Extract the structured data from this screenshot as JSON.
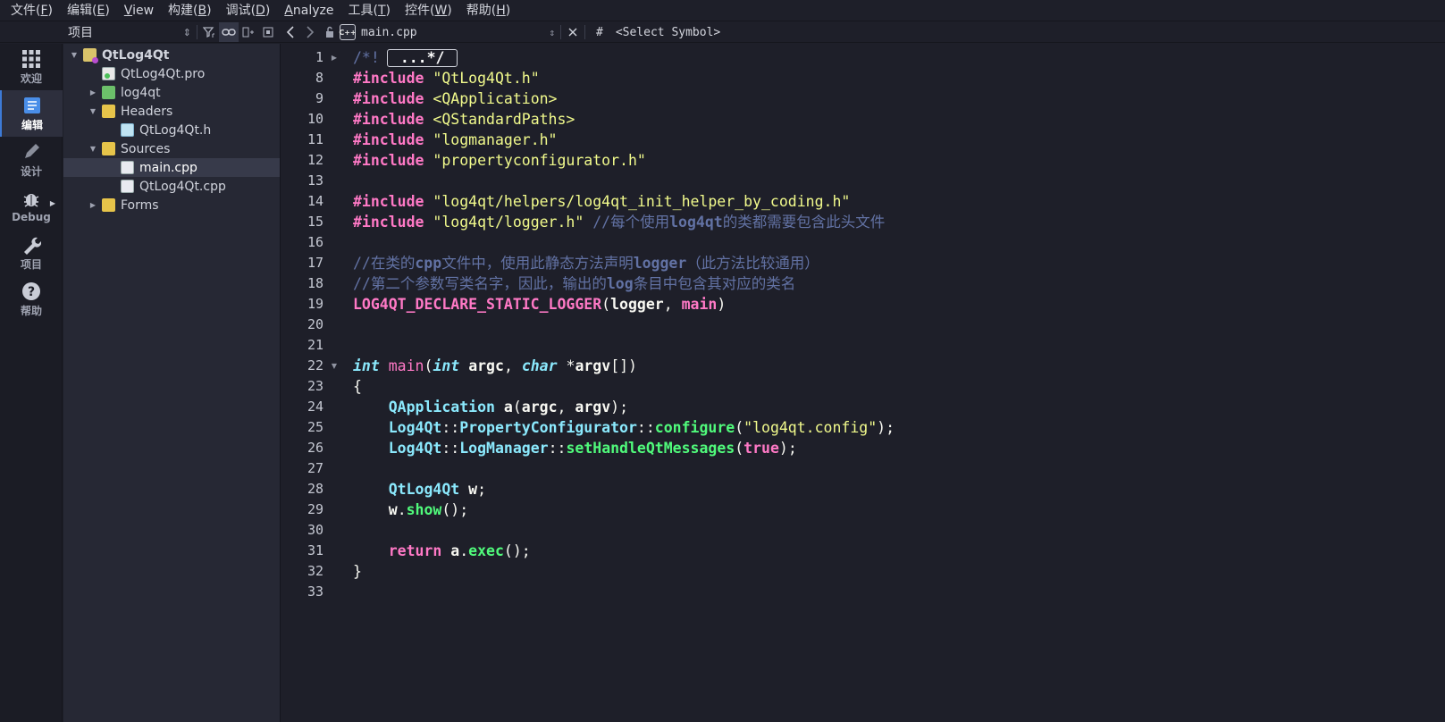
{
  "menubar": {
    "items": [
      {
        "label": "文件(",
        "key": "F",
        "tail": ")"
      },
      {
        "label": "编辑(",
        "key": "E",
        "tail": ")"
      },
      {
        "label": "",
        "key": "V",
        "tail": "iew"
      },
      {
        "label": "构建(",
        "key": "B",
        "tail": ")"
      },
      {
        "label": "调试(",
        "key": "D",
        "tail": ")"
      },
      {
        "label": "",
        "key": "A",
        "tail": "nalyze"
      },
      {
        "label": "工具(",
        "key": "T",
        "tail": ")"
      },
      {
        "label": "控件(",
        "key": "W",
        "tail": ")"
      },
      {
        "label": "帮助(",
        "key": "H",
        "tail": ")"
      }
    ]
  },
  "project_toolbar": {
    "title": "项目",
    "combo_arrow": "⇕"
  },
  "editor_toolbar": {
    "file_name": "main.cpp",
    "cpp_badge": "C++",
    "hash": "#",
    "symbol": "<Select Symbol>"
  },
  "modes": [
    {
      "label": "欢迎",
      "icon": "grid-icon"
    },
    {
      "label": "编辑",
      "icon": "edit-doc-icon"
    },
    {
      "label": "设计",
      "icon": "pencil-icon"
    },
    {
      "label": "Debug",
      "icon": "bug-icon"
    },
    {
      "label": "项目",
      "icon": "wrench-icon"
    },
    {
      "label": "帮助",
      "icon": "help-icon"
    }
  ],
  "tree": [
    {
      "label": "QtLog4Qt",
      "depth": 0,
      "arrow": "▼",
      "icon": "project-icon",
      "bold": true
    },
    {
      "label": "QtLog4Qt.pro",
      "depth": 1,
      "arrow": "",
      "icon": "pro-file-icon"
    },
    {
      "label": "log4qt",
      "depth": 1,
      "arrow": "▶",
      "icon": "folder-green-icon"
    },
    {
      "label": "Headers",
      "depth": 1,
      "arrow": "▼",
      "icon": "folder-headers-icon"
    },
    {
      "label": "QtLog4Qt.h",
      "depth": 2,
      "arrow": "",
      "icon": "header-file-icon"
    },
    {
      "label": "Sources",
      "depth": 1,
      "arrow": "▼",
      "icon": "folder-sources-icon"
    },
    {
      "label": "main.cpp",
      "depth": 2,
      "arrow": "",
      "icon": "cpp-file-icon",
      "selected": true
    },
    {
      "label": "QtLog4Qt.cpp",
      "depth": 2,
      "arrow": "",
      "icon": "cpp-file-icon"
    },
    {
      "label": "Forms",
      "depth": 1,
      "arrow": "▶",
      "icon": "folder-forms-icon"
    }
  ],
  "editor": {
    "line_numbers": [
      "1",
      "8",
      "9",
      "10",
      "11",
      "12",
      "13",
      "14",
      "15",
      "16",
      "17",
      "18",
      "19",
      "20",
      "21",
      "22",
      "23",
      "24",
      "25",
      "26",
      "27",
      "28",
      "29",
      "30",
      "31",
      "32",
      "33"
    ],
    "fold_markers": {
      "1": "▶",
      "22": "▼"
    },
    "lines": [
      [
        [
          "cmt",
          "/*!"
        ],
        [
          "fold",
          "...*/"
        ]
      ],
      [
        [
          "kw",
          "#include"
        ],
        [
          "pn",
          " "
        ],
        [
          "str",
          "\"QtLog4Qt.h\""
        ]
      ],
      [
        [
          "kw",
          "#include"
        ],
        [
          "pn",
          " "
        ],
        [
          "str",
          "<QApplication>"
        ]
      ],
      [
        [
          "kw",
          "#include"
        ],
        [
          "pn",
          " "
        ],
        [
          "str",
          "<QStandardPaths>"
        ]
      ],
      [
        [
          "kw",
          "#include"
        ],
        [
          "pn",
          " "
        ],
        [
          "str",
          "\"logmanager.h\""
        ]
      ],
      [
        [
          "kw",
          "#include"
        ],
        [
          "pn",
          " "
        ],
        [
          "str",
          "\"propertyconfigurator.h\""
        ]
      ],
      [],
      [
        [
          "kw",
          "#include"
        ],
        [
          "pn",
          " "
        ],
        [
          "str",
          "\"log4qt/helpers/log4qt_init_helper_by_coding.h\""
        ]
      ],
      [
        [
          "kw",
          "#include"
        ],
        [
          "pn",
          " "
        ],
        [
          "str",
          "\"log4qt/logger.h\""
        ],
        [
          "pn",
          " "
        ],
        [
          "cmt",
          "//每个使用"
        ],
        [
          "cmt-b",
          "log4qt"
        ],
        [
          "cmt",
          "的类都需要包含此头文件"
        ]
      ],
      [],
      [
        [
          "cmt",
          "//在类的"
        ],
        [
          "cmt-b",
          "cpp"
        ],
        [
          "cmt",
          "文件中，使用此静态方法声明"
        ],
        [
          "cmt-b",
          "logger"
        ],
        [
          "cmt",
          "（此方法比较通用）"
        ]
      ],
      [
        [
          "cmt",
          "//第二个参数写类名字，因此，输出的"
        ],
        [
          "cmt-b",
          "log"
        ],
        [
          "cmt",
          "条目中包含其对应的类名"
        ]
      ],
      [
        [
          "macro",
          "LOG4QT_DECLARE_STATIC_LOGGER"
        ],
        [
          "pn",
          "("
        ],
        [
          "id",
          "logger"
        ],
        [
          "pn",
          ", "
        ],
        [
          "kwv",
          "main"
        ],
        [
          "pn",
          ")"
        ]
      ],
      [],
      [],
      [
        [
          "ty",
          "int"
        ],
        [
          "pn",
          " "
        ],
        [
          "fn",
          "main"
        ],
        [
          "pn",
          "("
        ],
        [
          "ty",
          "int"
        ],
        [
          "pn",
          " "
        ],
        [
          "id",
          "argc"
        ],
        [
          "pn",
          ", "
        ],
        [
          "ty",
          "char"
        ],
        [
          "pn",
          " *"
        ],
        [
          "id",
          "argv"
        ],
        [
          "pn",
          "[])"
        ]
      ],
      [
        [
          "pn",
          "{"
        ]
      ],
      [
        [
          "pn",
          "    "
        ],
        [
          "cls",
          "QApplication"
        ],
        [
          "pn",
          " "
        ],
        [
          "id",
          "a"
        ],
        [
          "pn",
          "("
        ],
        [
          "id",
          "argc"
        ],
        [
          "pn",
          ", "
        ],
        [
          "id",
          "argv"
        ],
        [
          "pn",
          ");"
        ]
      ],
      [
        [
          "pn",
          "    "
        ],
        [
          "ns",
          "Log4Qt"
        ],
        [
          "pn",
          "::"
        ],
        [
          "ns",
          "PropertyConfigurator"
        ],
        [
          "pn",
          "::"
        ],
        [
          "call",
          "configure"
        ],
        [
          "pn",
          "("
        ],
        [
          "str",
          "\"log4qt.config\""
        ],
        [
          "pn",
          ");"
        ]
      ],
      [
        [
          "pn",
          "    "
        ],
        [
          "ns",
          "Log4Qt"
        ],
        [
          "pn",
          "::"
        ],
        [
          "ns",
          "LogManager"
        ],
        [
          "pn",
          "::"
        ],
        [
          "call",
          "setHandleQtMessages"
        ],
        [
          "pn",
          "("
        ],
        [
          "kwv",
          "true"
        ],
        [
          "pn",
          ");"
        ]
      ],
      [],
      [
        [
          "pn",
          "    "
        ],
        [
          "cls",
          "QtLog4Qt"
        ],
        [
          "pn",
          " "
        ],
        [
          "id",
          "w"
        ],
        [
          "pn",
          ";"
        ]
      ],
      [
        [
          "pn",
          "    "
        ],
        [
          "id",
          "w"
        ],
        [
          "pn",
          "."
        ],
        [
          "call",
          "show"
        ],
        [
          "pn",
          "();"
        ]
      ],
      [],
      [
        [
          "pn",
          "    "
        ],
        [
          "kw",
          "return"
        ],
        [
          "pn",
          " "
        ],
        [
          "id",
          "a"
        ],
        [
          "pn",
          "."
        ],
        [
          "call",
          "exec"
        ],
        [
          "pn",
          "();"
        ]
      ],
      [
        [
          "pn",
          "}"
        ]
      ],
      []
    ]
  }
}
